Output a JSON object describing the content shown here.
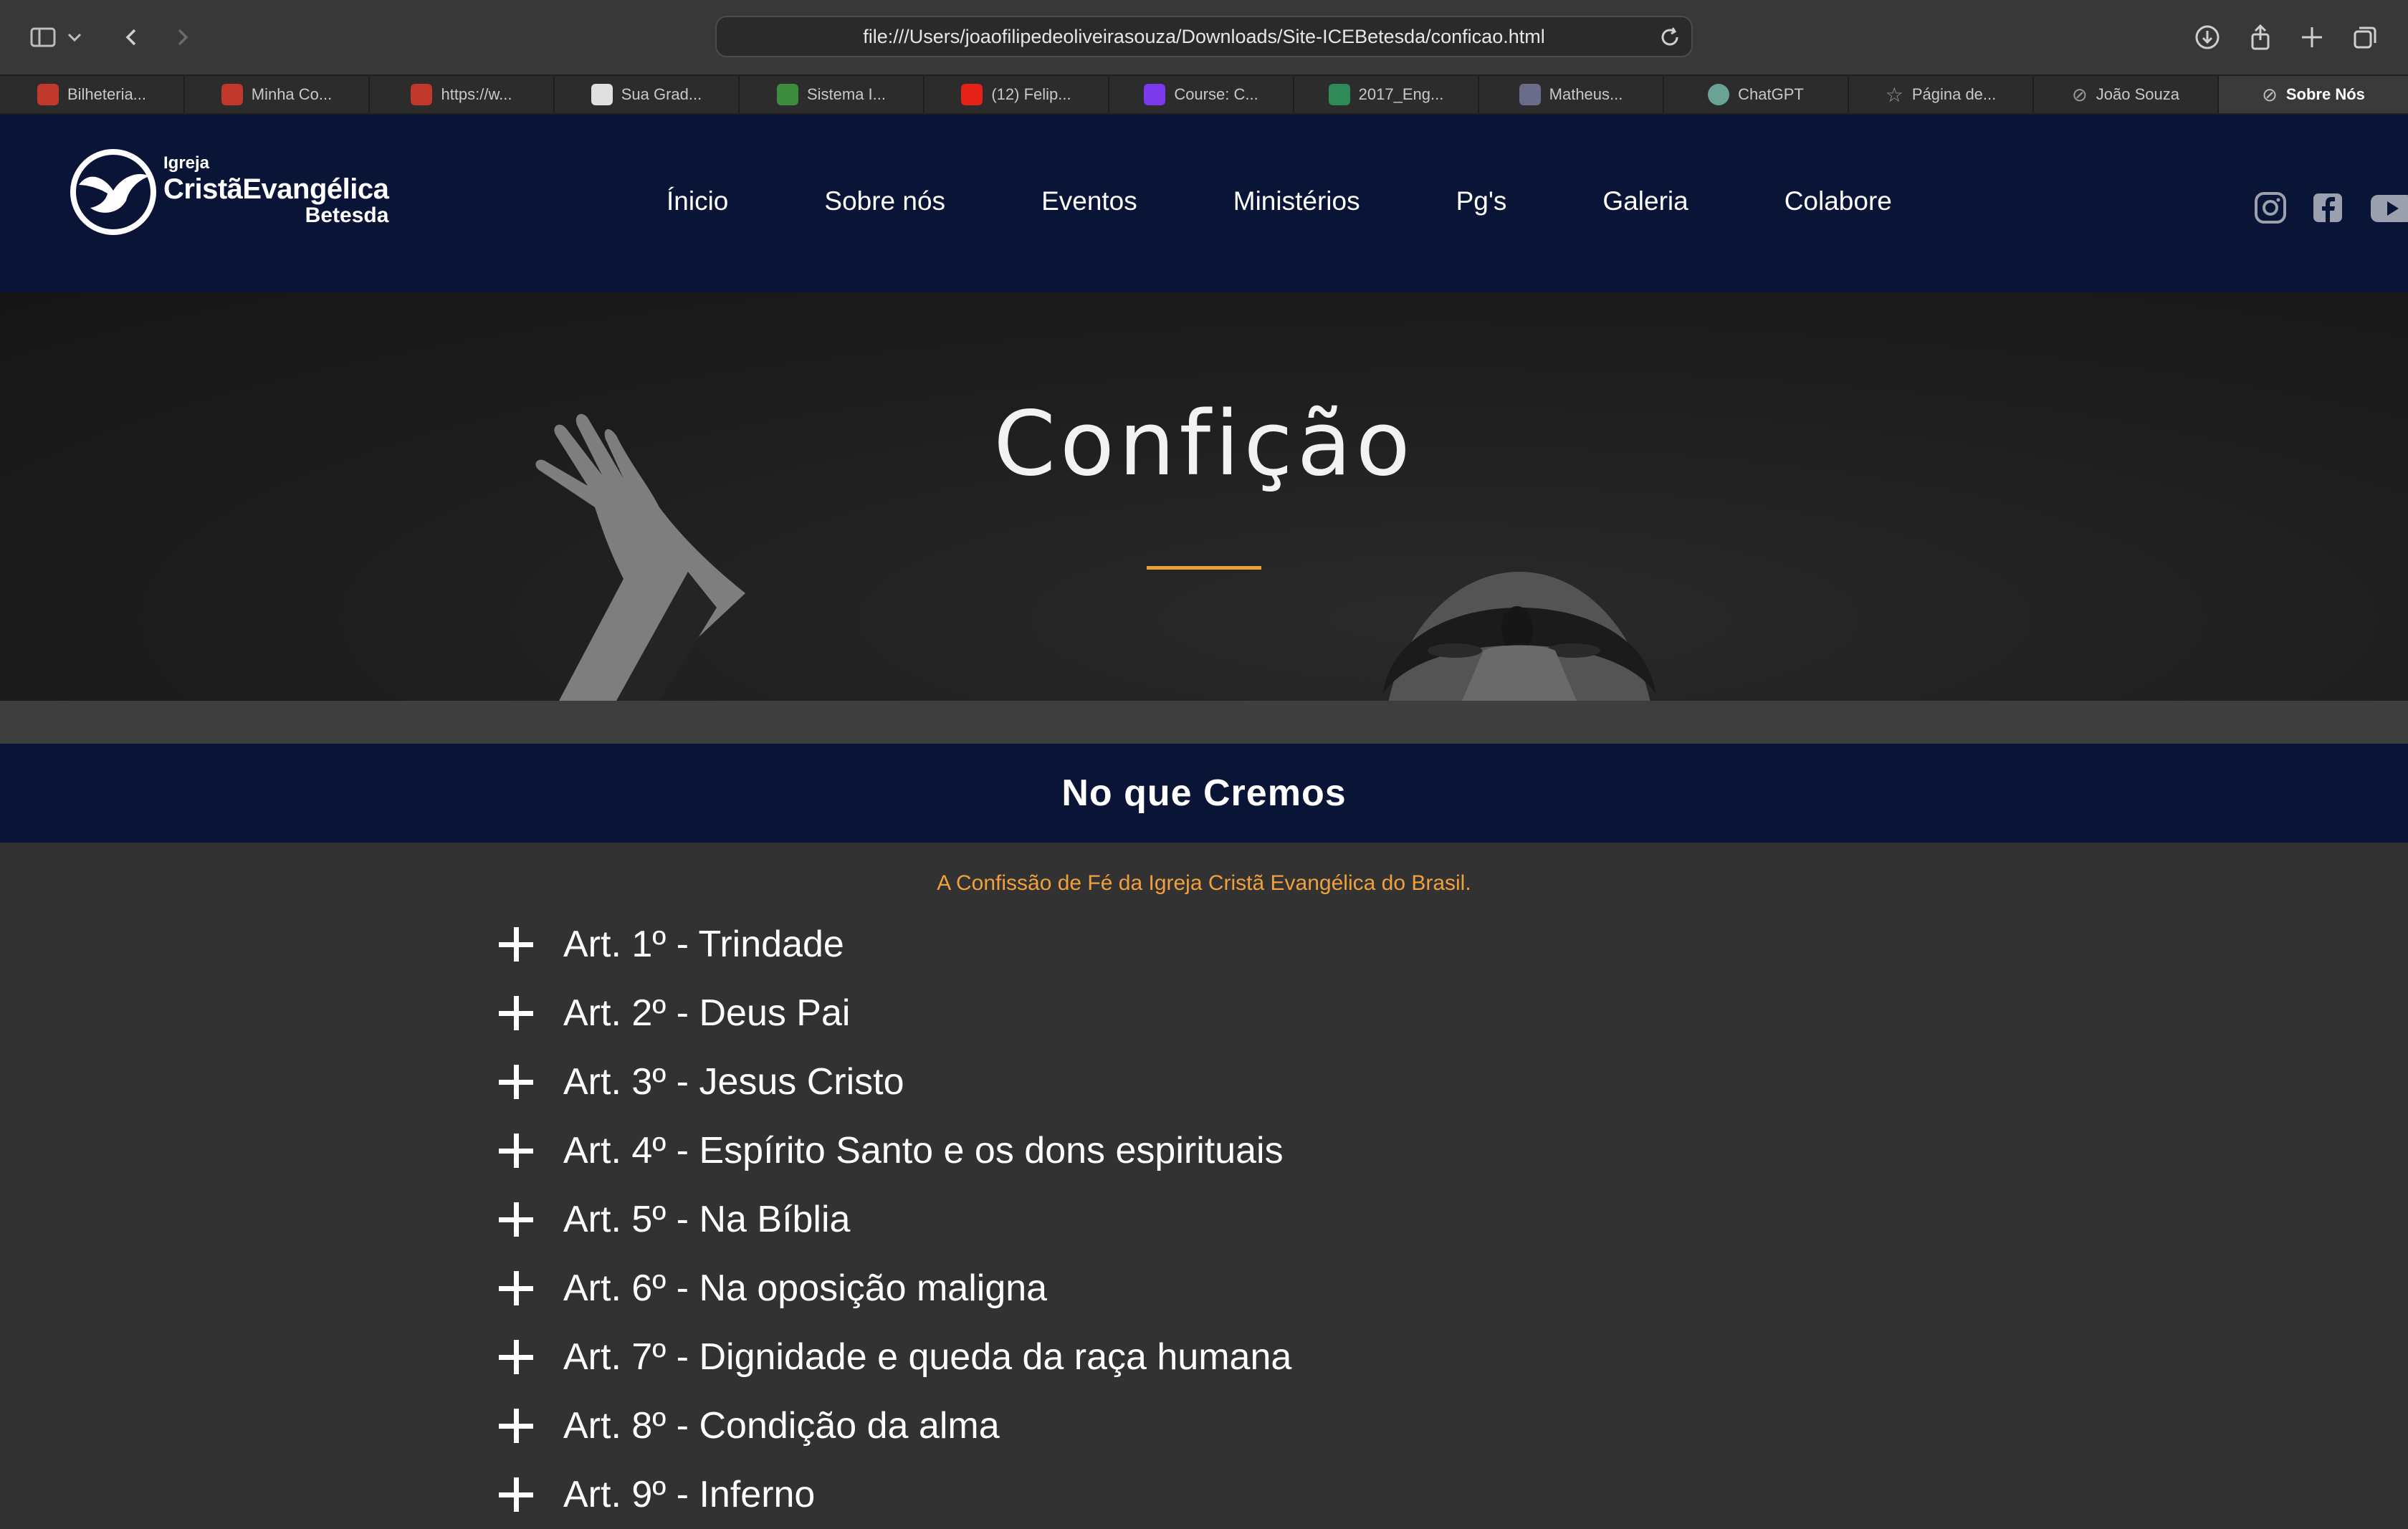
{
  "browser": {
    "url": "file:///Users/joaofilipedeoliveirasouza/Downloads/Site-ICEBetesda/conficao.html",
    "tabs": [
      {
        "label": "Bilheteria...",
        "favicon_color": "#c0392b"
      },
      {
        "label": "Minha Co...",
        "favicon_color": "#c0392b"
      },
      {
        "label": "https://w...",
        "favicon_color": "#c0392b"
      },
      {
        "label": "Sua Grad...",
        "favicon_color": "#e0e0e0"
      },
      {
        "label": "Sistema I...",
        "favicon_color": "#3d8b3d"
      },
      {
        "label": "(12) Felip...",
        "favicon_color": "#e62117"
      },
      {
        "label": "Course: C...",
        "favicon_color": "#7c3aed"
      },
      {
        "label": "2017_Eng...",
        "favicon_color": "#2e8b57"
      },
      {
        "label": "Matheus...",
        "favicon_color": "#6b6b8a"
      },
      {
        "label": "ChatGPT",
        "favicon_color": "#6aa295"
      },
      {
        "label": "Página de...",
        "favicon_color": "#9a9a9a"
      },
      {
        "label": "João Souza",
        "favicon_color": "#9a9a9a"
      },
      {
        "label": "Sobre Nós",
        "favicon_color": "#9a9a9a",
        "active": true
      }
    ]
  },
  "site": {
    "logo": {
      "line1": "Igreja",
      "line2": "CristãEvangélica",
      "line3": "Betesda"
    },
    "nav": [
      "Ínicio",
      "Sobre nós",
      "Eventos",
      "Ministérios",
      "Pg's",
      "Galeria",
      "Colabore"
    ],
    "social_icons": [
      "instagram-icon",
      "facebook-icon",
      "youtube-icon"
    ]
  },
  "hero": {
    "title": "Confição",
    "accent_color": "#e8a033"
  },
  "section": {
    "title": "No que Cremos",
    "subtitle": "A Confissão de Fé da Igreja Cristã Evangélica do Brasil."
  },
  "articles": [
    "Art. 1º - Trindade",
    "Art. 2º - Deus Pai",
    "Art. 3º - Jesus Cristo",
    "Art. 4º - Espírito Santo e os dons espirituais",
    "Art. 5º - Na Bíblia",
    "Art. 6º - Na oposição maligna",
    "Art. 7º - Dignidade e queda da raça humana",
    "Art. 8º - Condição da alma",
    "Art. 9º - Inferno"
  ],
  "colors": {
    "navy": "#0a1437",
    "background": "#323232",
    "subtitle": "#f0a03c"
  }
}
